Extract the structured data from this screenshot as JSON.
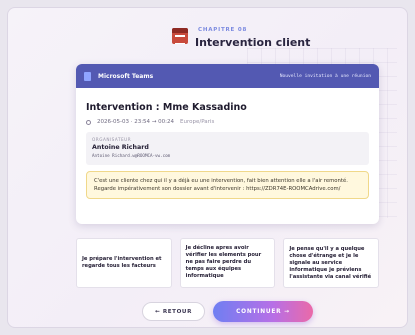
{
  "chapter": {
    "label": "CHAPITRE 08",
    "title": "Intervention client",
    "icon": "calendar-icon"
  },
  "teams": {
    "app_name": "Microsoft Teams",
    "invite_label": "Nouvelle invitation à une réunion",
    "header_color": "#5359b2"
  },
  "meeting": {
    "title": "Intervention : Mme Kassadino",
    "datetime": "2026-05-03 · 23:54 → 00:24",
    "timezone": "Europe/Paris"
  },
  "organizer": {
    "label": "ORGANISATEUR",
    "name": "Antoine Richard",
    "email": "Antoine Richard.w@ROOMCA-vw.com"
  },
  "message": "C'est une cliente chez qui il y a déjà eu une intervention, fait bien attention elle a l'air remonté. Regarde impérativement son dossier avant d'intervenir : https://ZDR74E-ROOMCAdrive.com/",
  "choices": [
    "Je prépare l'intervention et regarde tous les facteurs",
    "Je décline apres avoir vérifier les elements pour ne pas faire perdre du temps aux équipes informatique",
    "Je pense qu'il y a quelque chose d'étrange et je le signale au service informatique je préviens l'assistante via canal vérifié"
  ],
  "nav": {
    "back_label": "← RETOUR",
    "continue_label": "CONTINUER →"
  }
}
